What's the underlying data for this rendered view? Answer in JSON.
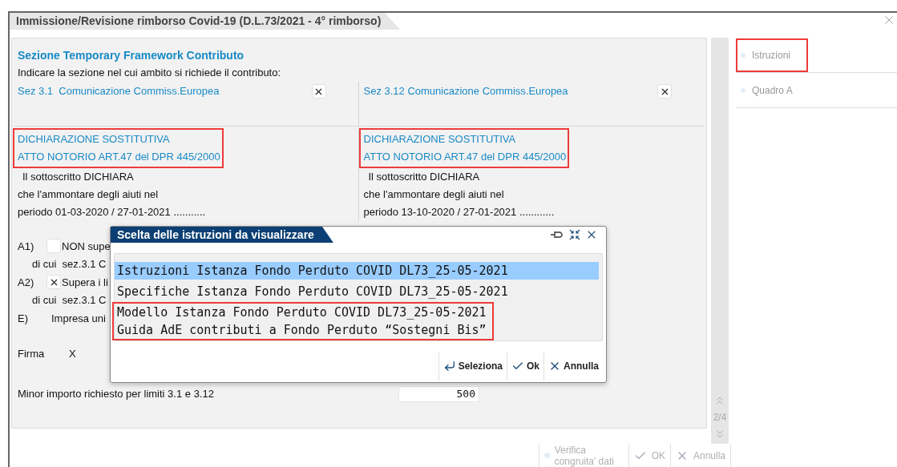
{
  "window": {
    "title": "Immissione/Revisione rimborso Covid-19 (D.L.73/2021 - 4° rimborso)"
  },
  "panel": {
    "heading": "Sezione Temporary Framework Contributo",
    "prompt": "Indicare la sezione nel cui ambito si richiede il contributo:",
    "sections": [
      {
        "label": "Sez 3.1  Comunicazione Commiss.Europea",
        "checked": true,
        "highlighted": true,
        "title_lines": [
          "DICHIARAZIONE SOSTITUTIVA",
          "ATTO NOTORIO ART.47 del DPR 445/2000"
        ],
        "body_lines": [
          "Il sottoscritto DICHIARA",
          "che l'ammontare degli aiuti nel",
          "periodo 01-03-2020 / 27-01-2021 ..........."
        ]
      },
      {
        "label": "Sez 3.12 Comunicazione Commiss.Europea",
        "checked": true,
        "highlighted": true,
        "title_lines": [
          "DICHIARAZIONE SOSTITUTIVA",
          "ATTO NOTORIO ART.47 del DPR 445/2000"
        ],
        "body_lines": [
          "Il sottoscritto DICHIARA",
          "che l'ammontare degli aiuti nel",
          "periodo 13-10-2020 / 27-01-2021 ............"
        ]
      }
    ],
    "options": [
      {
        "kind": "checkbox",
        "code": "A1)",
        "checked": false,
        "text": "NON supe"
      },
      {
        "kind": "sub",
        "text": "di cui  sez.3.1 C"
      },
      {
        "kind": "checkbox",
        "code": "A2)",
        "checked": true,
        "text": "Supera i li"
      },
      {
        "kind": "sub",
        "text": "di cui  sez.3.1 C"
      },
      {
        "kind": "plain",
        "code": "E)",
        "text": "Impresa uni"
      }
    ],
    "signature": {
      "label": "Firma",
      "value": "X"
    },
    "amount": {
      "label": "Minor importo richiesto per limiti 3.1 e 3.12",
      "value": "500"
    }
  },
  "pager": "2/4",
  "nav": [
    {
      "label": "Istruzioni",
      "highlighted": true
    },
    {
      "label": "Quadro A",
      "highlighted": false
    }
  ],
  "footer_buttons": [
    {
      "kind": "verify",
      "label": "Verifica congruita' dati",
      "disabled": true
    },
    {
      "kind": "ok",
      "label": "OK",
      "disabled": true
    },
    {
      "kind": "cancel",
      "label": "Annulla",
      "disabled": true
    }
  ],
  "dialog": {
    "title": "Scelta delle istruzioni da visualizzare",
    "items": [
      {
        "label": "Istruzioni Istanza Fondo Perduto COVID DL73_25-05-2021",
        "selected": true,
        "highlighted": false
      },
      {
        "label": "Specifiche Istanza Fondo Perduto COVID DL73_25-05-2021",
        "selected": false,
        "highlighted": false
      },
      {
        "label": "Modello Istanza Fondo Perduto COVID DL73_25-05-2021",
        "selected": false,
        "highlighted": true
      },
      {
        "label": "Guida AdE contributi a Fondo Perduto “Sostegni Bis”",
        "selected": false,
        "highlighted": true
      }
    ],
    "buttons": [
      {
        "kind": "select",
        "label": "Seleziona"
      },
      {
        "kind": "ok",
        "label": "Ok"
      },
      {
        "kind": "cancel",
        "label": "Annulla"
      }
    ]
  }
}
